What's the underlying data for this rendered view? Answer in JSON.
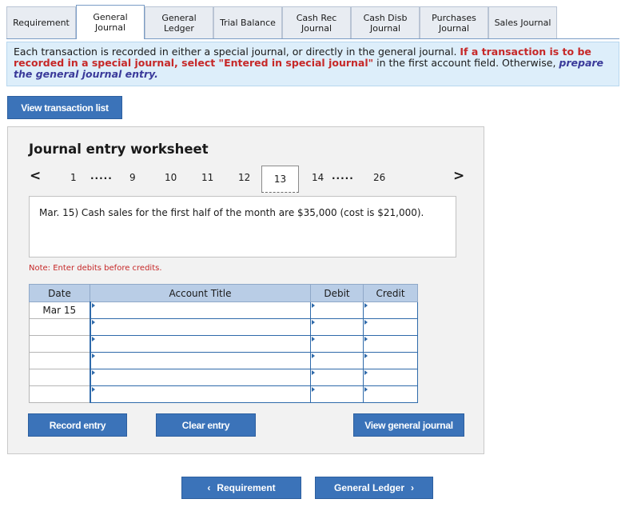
{
  "tabs": [
    {
      "label": "Requirement"
    },
    {
      "label": "General\nJournal"
    },
    {
      "label": "General\nLedger"
    },
    {
      "label": "Trial Balance"
    },
    {
      "label": "Cash Rec\nJournal"
    },
    {
      "label": "Cash Disb\nJournal"
    },
    {
      "label": "Purchases\nJournal"
    },
    {
      "label": "Sales Journal"
    }
  ],
  "instruction": {
    "part1": "Each transaction is recorded in either a special journal, or directly in the general journal. ",
    "part2": "If a transaction is to be recorded in a special journal, select \"Entered in special journal\"",
    "part3": " in the first account field.  Otherwise, ",
    "part4": "prepare the general journal entry."
  },
  "view_transaction_list": "View transaction list",
  "worksheet": {
    "title": "Journal entry worksheet",
    "pager": {
      "prev": "<",
      "next": ">",
      "pages": [
        "1",
        "9",
        "10",
        "11",
        "12",
        "13",
        "14",
        "26"
      ],
      "dots": ".....",
      "current": "13"
    },
    "description": "Mar. 15) Cash sales for the first half of the month are $35,000 (cost is $21,000).",
    "note": "Note: Enter debits before credits.",
    "table": {
      "headers": {
        "date": "Date",
        "account": "Account Title",
        "debit": "Debit",
        "credit": "Credit"
      },
      "rows": [
        {
          "date": "Mar 15"
        },
        {
          "date": ""
        },
        {
          "date": ""
        },
        {
          "date": ""
        },
        {
          "date": ""
        },
        {
          "date": ""
        }
      ]
    },
    "buttons": {
      "record": "Record entry",
      "clear": "Clear entry",
      "view_gj": "View general journal"
    }
  },
  "nav": {
    "prev_label": "Requirement",
    "next_label": "General Ledger",
    "prev_icon": "chevron-left-icon",
    "next_icon": "chevron-right-icon"
  }
}
